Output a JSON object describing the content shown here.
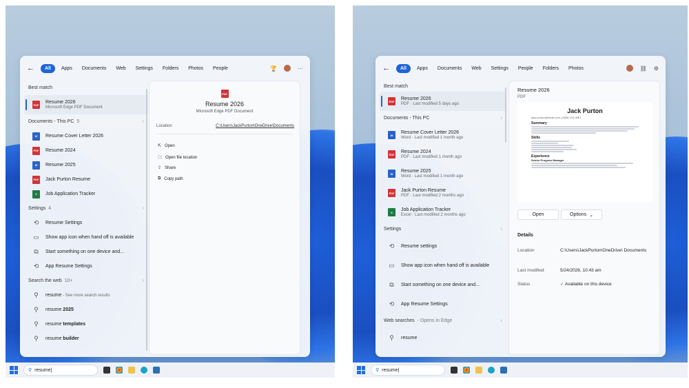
{
  "left": {
    "taskbar": {
      "search_value": "resume|"
    },
    "topbar": {
      "back": "←",
      "tabs": [
        "All",
        "Apps",
        "Documents",
        "Web",
        "Settings",
        "Folders",
        "Photos",
        "People"
      ],
      "more": "···"
    },
    "list": {
      "best_match_header": "Best match",
      "best_match": {
        "title": "Resume 2026",
        "subtitle": "Microsoft Edge PDF Document"
      },
      "documents_header": "Documents - This PC",
      "documents_count": "5",
      "documents": [
        "Resume Cover Letter 2026",
        "Resume 2024",
        "Resume 2025",
        "Jack Purton Resume",
        "Job Application Tracker"
      ],
      "settings_header": "Settings",
      "settings_count": "4",
      "settings": [
        "Resume Settings",
        "Show app icon when hand off is available",
        "Start something on one device and...",
        "App Resume Settings"
      ],
      "web_header": "Search the web",
      "web_count": "10+",
      "web": [
        {
          "plain": "resume",
          "extra": " - See more search results"
        },
        {
          "plain": "resume ",
          "extra": "2025"
        },
        {
          "plain": "resume ",
          "extra": "templates"
        },
        {
          "plain": "resume ",
          "extra": "builder"
        }
      ]
    },
    "detail": {
      "title": "Resume 2026",
      "subtitle": "Microsoft Edge PDF Document",
      "location_label": "Location",
      "location_value": "C:\\Users\\JackPurton\\OneDrive\\Documents",
      "actions": [
        "Open",
        "Open file location",
        "Share",
        "Copy path"
      ]
    }
  },
  "right": {
    "taskbar": {
      "search_value": "resume|"
    },
    "topbar": {
      "back": "←",
      "tabs": [
        "All",
        "Apps",
        "Documents",
        "Web",
        "Settings",
        "People",
        "Folders",
        "Photos"
      ]
    },
    "list": {
      "best_match_header": "Best match",
      "best_match": {
        "title": "Resume 2026",
        "subtitle": "PDF · Last modified 5 days ago"
      },
      "documents_header": "Documents - This PC",
      "documents": [
        {
          "title": "Resume Cover Letter 2026",
          "subtitle": "Word · Last modified 1 month ago",
          "type": "word"
        },
        {
          "title": "Resume 2024",
          "subtitle": "PDF · Last modified 1 month ago",
          "type": "pdf"
        },
        {
          "title": "Resume 2025",
          "subtitle": "Word · Last modified 1 month ago",
          "type": "word"
        },
        {
          "title": "Jack Purton Resume",
          "subtitle": "PDF · Last modified 2 months ago",
          "type": "pdf"
        },
        {
          "title": "Job Application Tracker",
          "subtitle": "Excel · Last modified 2 months ago",
          "type": "xls"
        }
      ],
      "settings_header": "Settings",
      "settings": [
        "Resume settings",
        "Show app icon when hand off is available",
        "Start something on one device and...",
        "App Resume Settings"
      ],
      "web_header": "Web searches",
      "web_note": " - Opens in Edge",
      "web": [
        "resume"
      ]
    },
    "detail": {
      "title": "Resume 2026",
      "type": "PDF",
      "preview": {
        "name": "Jack Purton",
        "contact": "jack.purton@email.com | (555) 123-4567",
        "h_summary": "Summary",
        "h_skills": "Skills",
        "h_experience": "Experience",
        "role": "Senior Program Manager"
      },
      "open_button": "Open",
      "options_button": "Options",
      "details_header": "Details",
      "location_label": "Location",
      "location_value": "C:\\Users\\JackPurton\\OneDrive\\ Documents",
      "modified_label": "Last modified",
      "modified_value": "5/24/2026, 10:43 am",
      "status_label": "Status",
      "status_value": "Available on this device"
    }
  },
  "colors": {
    "accent": "#1d64d8",
    "pdf": "#d13438",
    "word": "#2b63c5",
    "excel": "#1e7b43"
  }
}
